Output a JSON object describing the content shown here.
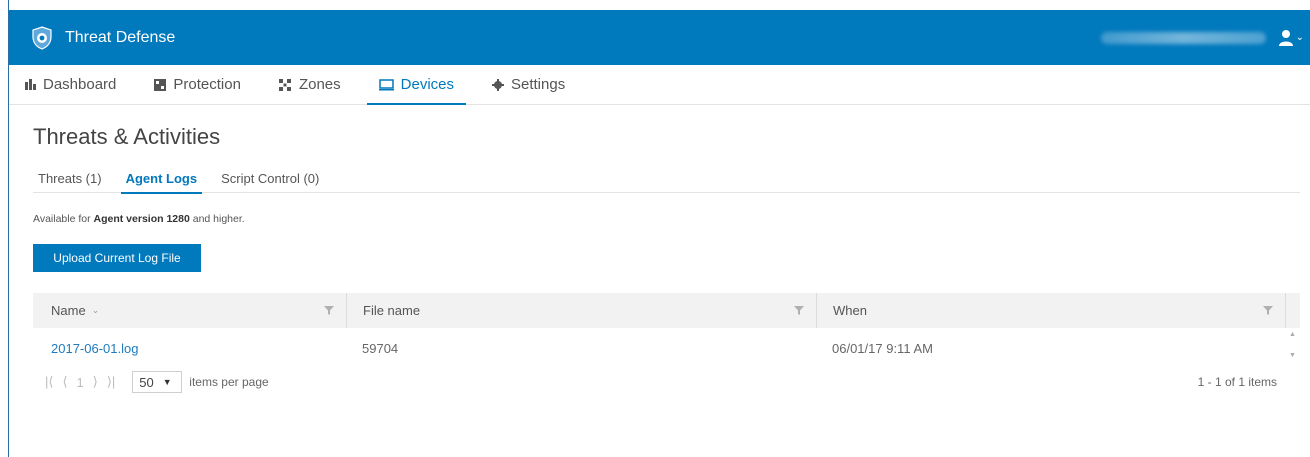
{
  "app": {
    "title": "Threat Defense",
    "brand_color": "#0079bd"
  },
  "nav": {
    "items": [
      {
        "label": "Dashboard",
        "icon": "bar-chart-icon"
      },
      {
        "label": "Protection",
        "icon": "shield-grid-icon"
      },
      {
        "label": "Zones",
        "icon": "zones-icon"
      },
      {
        "label": "Devices",
        "icon": "monitor-icon",
        "active": true
      },
      {
        "label": "Settings",
        "icon": "gear-icon"
      }
    ]
  },
  "page": {
    "title": "Threats & Activities"
  },
  "subtabs": [
    {
      "label": "Threats (1)"
    },
    {
      "label": "Agent Logs",
      "active": true
    },
    {
      "label": "Script Control (0)"
    }
  ],
  "note": {
    "prefix": "Available for ",
    "bold": "Agent version 1280",
    "suffix": " and higher."
  },
  "upload_button": "Upload Current Log File",
  "grid": {
    "columns": [
      "Name",
      "File name",
      "When"
    ],
    "rows": [
      {
        "name": "2017-06-01.log",
        "file_name": "59704",
        "when": "06/01/17 9:11 AM"
      }
    ]
  },
  "pager": {
    "current_page": "1",
    "page_size": "50",
    "items_per_page_label": "items per page",
    "summary": "1 - 1 of 1 items"
  }
}
